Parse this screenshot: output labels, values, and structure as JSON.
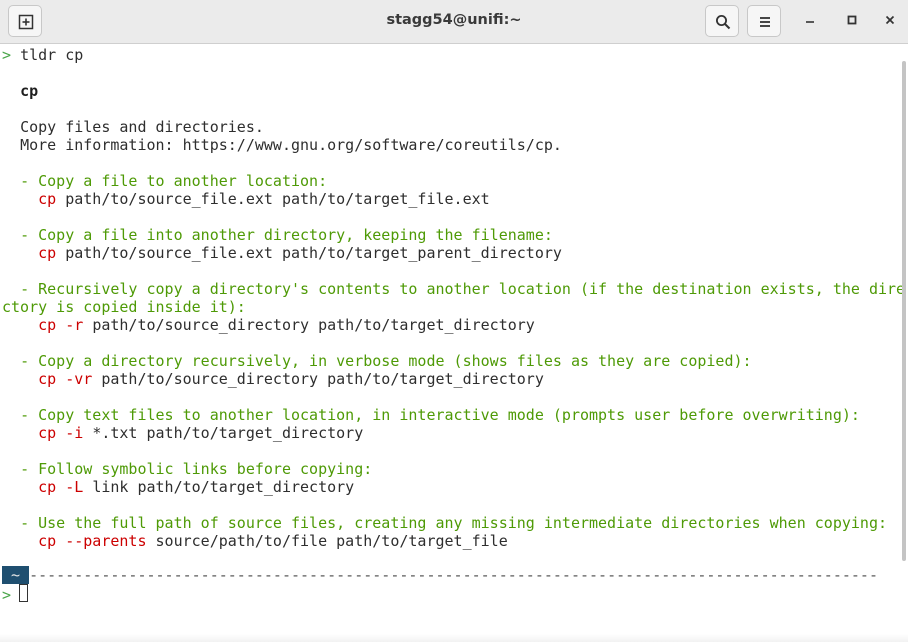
{
  "window": {
    "title": "stagg54@unifi:~"
  },
  "icons": {
    "new_tab": "new-tab-icon",
    "search": "search-icon",
    "menu": "hamburger-menu-icon",
    "minimize": "minimize-icon",
    "maximize": "maximize-icon",
    "close": "close-icon"
  },
  "colors": {
    "prompt": "#4aa64a",
    "description": "#4e9a06",
    "command": "#cc0000",
    "text": "#2e2e2e",
    "badge_bg": "#1f4f70"
  },
  "terminal": {
    "prompt_symbol": ">",
    "command": "tldr cp",
    "page_title": "cp",
    "summary": [
      "Copy files and directories.",
      "More information: https://www.gnu.org/software/coreutils/cp."
    ],
    "examples": [
      {
        "desc": "- Copy a file to another location:",
        "cmd": "cp",
        "flag": "",
        "args": "path/to/source_file.ext path/to/target_file.ext"
      },
      {
        "desc": "- Copy a file into another directory, keeping the filename:",
        "cmd": "cp",
        "flag": "",
        "args": "path/to/source_file.ext path/to/target_parent_directory"
      },
      {
        "desc": "- Recursively copy a directory's contents to another location (if the destination exists, the dire",
        "desc_wrap": "ctory is copied inside it):",
        "cmd": "cp",
        "flag": "-r",
        "args": "path/to/source_directory path/to/target_directory"
      },
      {
        "desc": "- Copy a directory recursively, in verbose mode (shows files as they are copied):",
        "cmd": "cp",
        "flag": "-vr",
        "args": "path/to/source_directory path/to/target_directory"
      },
      {
        "desc": "- Copy text files to another location, in interactive mode (prompts user before overwriting):",
        "cmd": "cp",
        "flag": "-i",
        "args": "*.txt path/to/target_directory"
      },
      {
        "desc": "- Follow symbolic links before copying:",
        "cmd": "cp",
        "flag": "-L",
        "args": "link path/to/target_directory"
      },
      {
        "desc": "- Use the full path of source files, creating any missing intermediate directories when copying:",
        "cmd": "cp",
        "flag": "--parents",
        "args": "source/path/to/file path/to/target_file"
      }
    ],
    "status_badge": "~",
    "separator": "----------------------------------------------------------------------------------------------",
    "second_prompt": ">"
  }
}
